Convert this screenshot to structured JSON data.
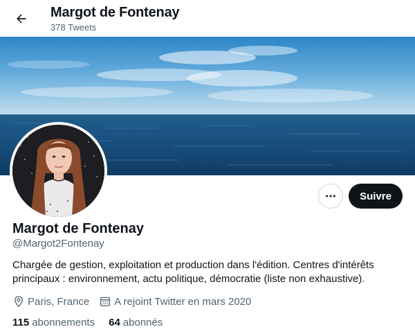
{
  "header": {
    "back_icon": "arrow-left-icon",
    "name": "Margot de Fontenay",
    "tweet_count": "378 Tweets"
  },
  "banner": {
    "description_icon": "sea-horizon-banner"
  },
  "profile": {
    "display_name": "Margot de Fontenay",
    "handle": "@Margot2Fontenay",
    "bio": "Chargée de gestion, exploitation et production dans l'édition. Centres d'intérêts principaux : environnement, actu politique, démocratie (liste non exhaustive).",
    "location": "Paris, France",
    "joined": "A rejoint Twitter en mars 2020",
    "location_icon": "location-pin-icon",
    "calendar_icon": "calendar-icon"
  },
  "actions": {
    "more_icon": "more-dots-icon",
    "follow_label": "Suivre"
  },
  "stats": {
    "following_count": "115",
    "following_label": "abonnements",
    "followers_count": "64",
    "followers_label": "abonnés"
  },
  "colors": {
    "text": "#0f1419",
    "secondary": "#536471",
    "follow_bg": "#0f1419",
    "border": "#cfd9de"
  }
}
